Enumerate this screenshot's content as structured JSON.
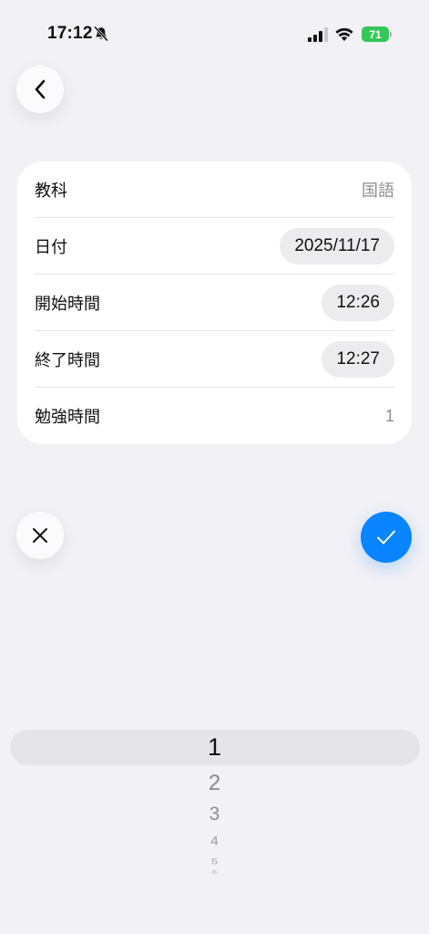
{
  "status_bar": {
    "time": "17:12",
    "battery": "71"
  },
  "form": {
    "rows": [
      {
        "label": "教科",
        "value": "国語"
      },
      {
        "label": "日付",
        "value": "2025/11/17"
      },
      {
        "label": "開始時間",
        "value": "12:26"
      },
      {
        "label": "終了時間",
        "value": "12:27"
      },
      {
        "label": "勉強時間",
        "value": "1"
      }
    ]
  },
  "picker": {
    "selected": "1",
    "options": [
      "1",
      "2",
      "3",
      "4",
      "5",
      "6"
    ]
  },
  "colors": {
    "background": "#f2f1f6",
    "accent": "#0a84ff",
    "battery": "#34c759"
  },
  "icons": {
    "back": "chevron-left-icon",
    "cancel": "close-icon",
    "confirm": "checkmark-icon",
    "muted": "bell-slash-icon"
  }
}
